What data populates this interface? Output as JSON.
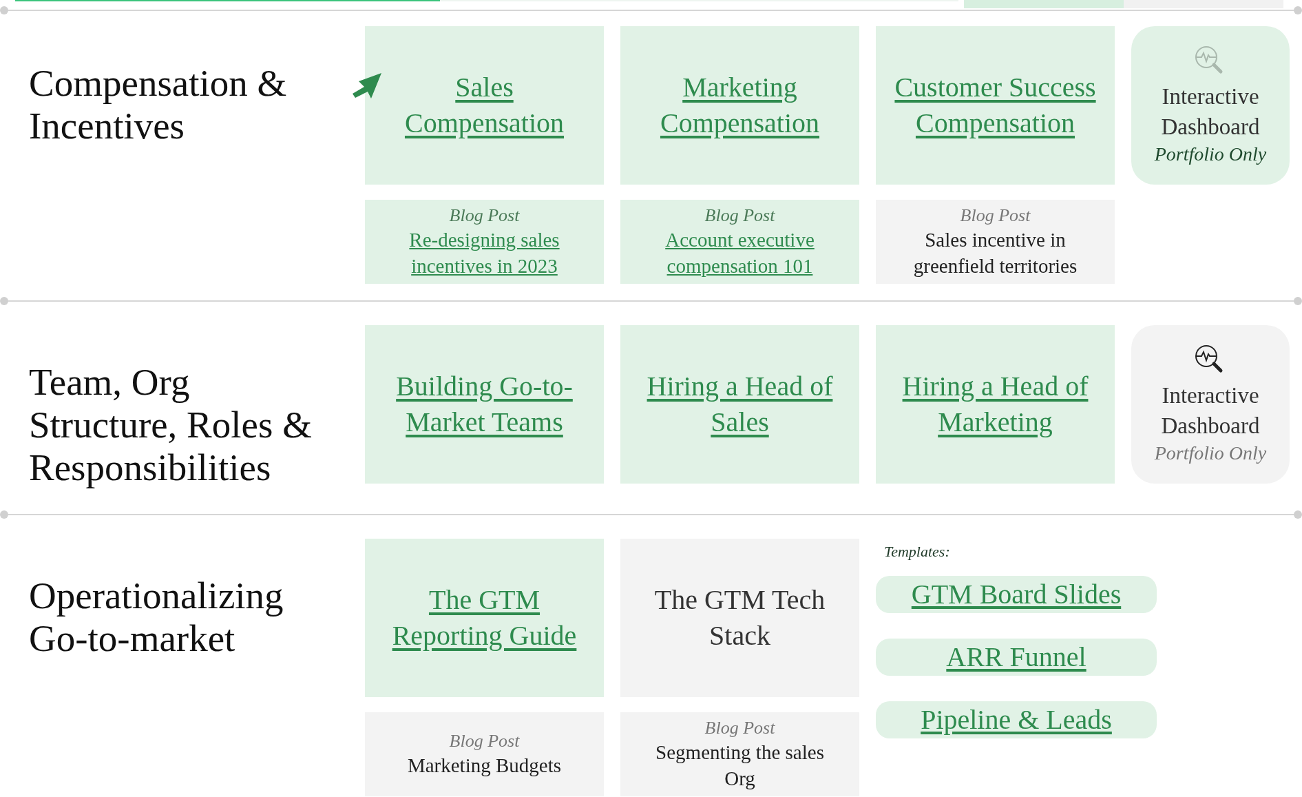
{
  "progress": {
    "level": 0.45
  },
  "tabs": [
    {
      "selected": true
    },
    {
      "selected": false
    }
  ],
  "sections": [
    {
      "title": "Compensation & Incentives",
      "arrow": true,
      "columns": [
        {
          "kind": "topic",
          "title": "Sales Compensation",
          "linked": true,
          "blog": {
            "label": "Blog Post",
            "title": "Re-designing sales incentives in 2023",
            "linked": true
          }
        },
        {
          "kind": "topic",
          "title": "Marketing Compensation",
          "linked": true,
          "blog": {
            "label": "Blog Post",
            "title": "Account executive compensation 101",
            "linked": true
          }
        },
        {
          "kind": "topic",
          "title": "Customer Success Compensation",
          "linked": true,
          "blog": {
            "label": "Blog Post",
            "title": "Sales incentive in greenfield territories",
            "linked": false
          }
        },
        {
          "kind": "dashboard",
          "title": "Interactive Dashboard",
          "note": "Portfolio Only",
          "available": true
        }
      ]
    },
    {
      "title": "Team, Org Structure, Roles & Responsibilities",
      "arrow": false,
      "columns": [
        {
          "kind": "topic",
          "title": "Building Go-to-Market Teams",
          "linked": true
        },
        {
          "kind": "topic",
          "title": "Hiring a Head of Sales",
          "linked": true
        },
        {
          "kind": "topic",
          "title": "Hiring a Head of Marketing",
          "linked": true
        },
        {
          "kind": "dashboard",
          "title": "Interactive Dashboard",
          "note": "Portfolio Only",
          "available": false
        }
      ]
    },
    {
      "title": "Operationalizing Go-to-market",
      "arrow": false,
      "columns": [
        {
          "kind": "topic",
          "title": "The GTM Reporting Guide",
          "linked": true,
          "blog": {
            "label": "Blog Post",
            "title": "Marketing Budgets",
            "linked": false
          }
        },
        {
          "kind": "topic",
          "title": "The GTM Tech Stack",
          "linked": false,
          "blog": {
            "label": "Blog Post",
            "title": "Segmenting the sales Org",
            "linked": false
          }
        },
        {
          "kind": "templates",
          "label": "Templates:",
          "links": [
            "GTM Board Slides",
            "ARR Funnel",
            "Pipeline & Leads"
          ]
        }
      ]
    }
  ]
}
